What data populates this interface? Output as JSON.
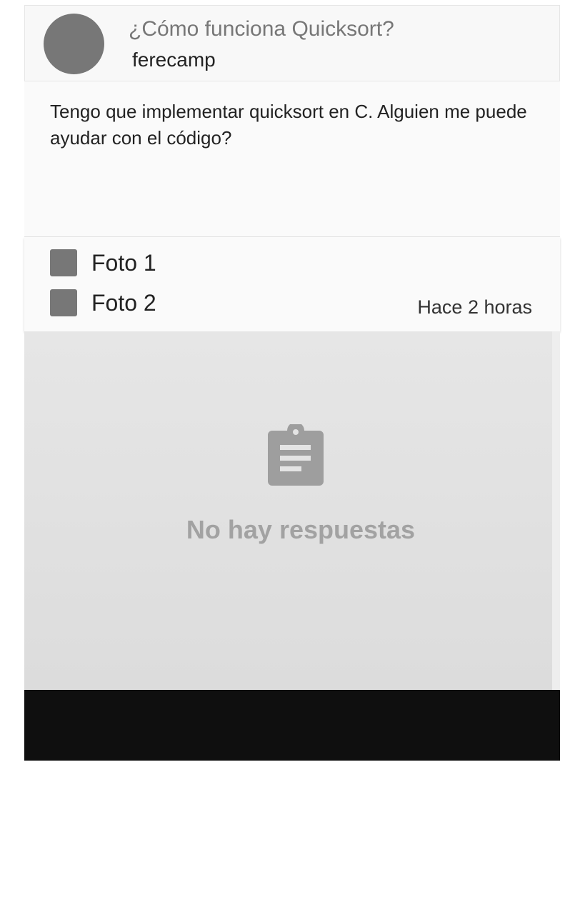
{
  "post": {
    "title": "¿Cómo funciona Quicksort?",
    "author": "ferecamp",
    "body": "Tengo que implementar quicksort en C. Alguien me puede ayudar con el código?",
    "attachments": [
      {
        "label": "Foto 1"
      },
      {
        "label": "Foto 2"
      }
    ],
    "time": "Hace 2 horas"
  },
  "answers": {
    "empty_icon": "clipboard-icon",
    "empty_text": "No hay respuestas"
  },
  "colors": {
    "placeholder_gray": "#777777",
    "empty_text": "#a2a2a2",
    "bottom_bar": "#0f0f0f"
  }
}
